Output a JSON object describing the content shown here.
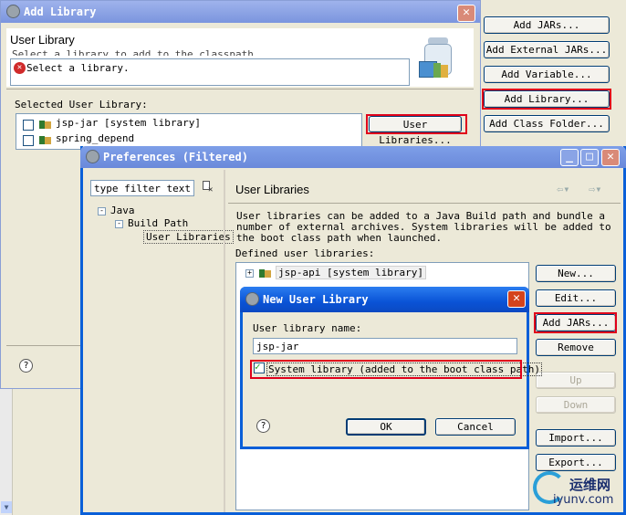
{
  "add_library": {
    "title": "Add Library",
    "heading": "User Library",
    "subtitle_partial": "Select a library to add to the classpath",
    "error_message": "Select a library.",
    "selected_label": "Selected User Library:",
    "libraries": [
      "jsp-jar [system library]",
      "spring_depend"
    ],
    "user_libraries_button": "User Libraries..."
  },
  "right_buttons": {
    "add_jars": "Add JARs...",
    "add_external_jars": "Add External JARs...",
    "add_variable": "Add Variable...",
    "add_library": "Add Library...",
    "add_class_folder": "Add Class Folder..."
  },
  "preferences": {
    "title": "Preferences (Filtered)",
    "filter_value": "type filter text",
    "tree": [
      "Java",
      "Build Path",
      "User Libraries"
    ],
    "page_title": "User Libraries",
    "description": "User libraries can be added to a Java Build path and bundle a number of external archives. System libraries will be added to the boot class path when launched.",
    "defined_label": "Defined user libraries:",
    "libraries": [
      "jsp-api [system library]"
    ],
    "buttons": {
      "new": "New...",
      "edit": "Edit...",
      "add_jars": "Add JARs...",
      "remove": "Remove",
      "up": "Up",
      "down": "Down",
      "import": "Import...",
      "export": "Export..."
    }
  },
  "new_user_library": {
    "title": "New User Library",
    "name_label": "User library name:",
    "name_value": "jsp-jar",
    "system_checkbox_label": "System library (added to the boot class path)",
    "system_checked": true,
    "ok": "OK",
    "cancel": "Cancel"
  },
  "watermark": {
    "text_cn": "运维网",
    "text_url": "iyunv.com"
  },
  "colors": {
    "title_active": "#0a5fd8",
    "title_inactive": "#7a96df",
    "highlight_red": "#e0001a"
  }
}
